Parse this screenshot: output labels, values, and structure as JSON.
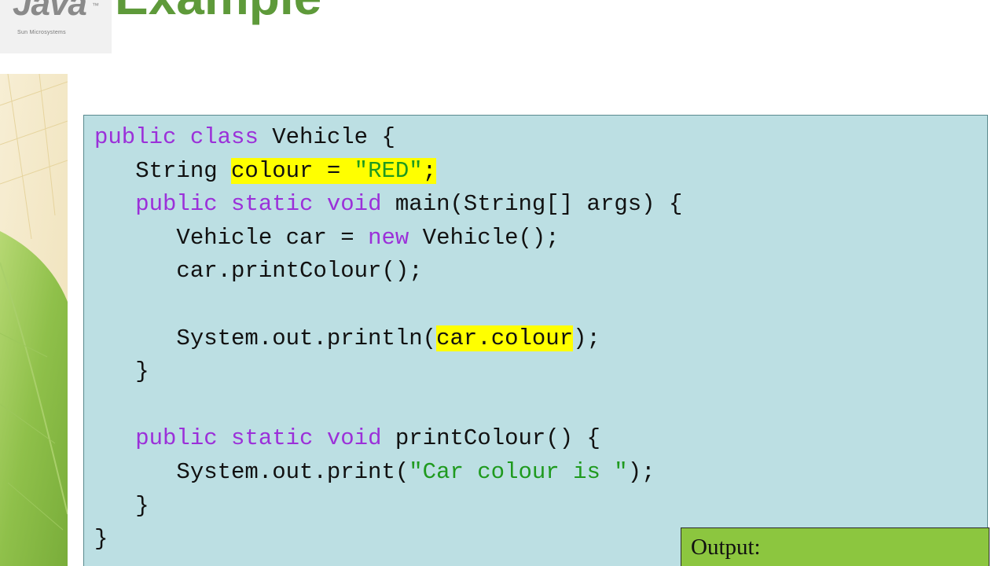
{
  "logo": {
    "word": "Java",
    "tm": "™",
    "sub": "Sun Microsystems"
  },
  "title": "Example",
  "code_lines": [
    [
      {
        "t": "public",
        "c": "kw"
      },
      {
        "t": " "
      },
      {
        "t": "class",
        "c": "kw"
      },
      {
        "t": " Vehicle {"
      }
    ],
    [
      {
        "t": "   String "
      },
      {
        "t": "colour = ",
        "c": "hl"
      },
      {
        "t": "\"RED\"",
        "c": "str hl"
      },
      {
        "t": ";",
        "c": "hl"
      }
    ],
    [
      {
        "t": "   "
      },
      {
        "t": "public",
        "c": "kw"
      },
      {
        "t": " "
      },
      {
        "t": "static",
        "c": "kw"
      },
      {
        "t": " "
      },
      {
        "t": "void",
        "c": "kw"
      },
      {
        "t": " main(String[] args) {"
      }
    ],
    [
      {
        "t": "      Vehicle car = "
      },
      {
        "t": "new",
        "c": "kw"
      },
      {
        "t": " Vehicle();"
      }
    ],
    [
      {
        "t": "      car.printColour();"
      }
    ],
    [],
    [
      {
        "t": "      System.out.println("
      },
      {
        "t": "car.colour",
        "c": "hl"
      },
      {
        "t": ");"
      }
    ],
    [
      {
        "t": "   }"
      }
    ],
    [],
    [
      {
        "t": "   "
      },
      {
        "t": "public",
        "c": "kw"
      },
      {
        "t": " "
      },
      {
        "t": "static",
        "c": "kw"
      },
      {
        "t": " "
      },
      {
        "t": "void",
        "c": "kw"
      },
      {
        "t": " printColour() {"
      }
    ],
    [
      {
        "t": "      System.out.print("
      },
      {
        "t": "\"Car colour is \"",
        "c": "str"
      },
      {
        "t": ");"
      }
    ],
    [
      {
        "t": "   }"
      }
    ],
    [
      {
        "t": "}"
      }
    ]
  ],
  "output": {
    "label": "Output:"
  },
  "colors": {
    "keyword": "#9b30d9",
    "string": "#1f9a1f",
    "highlight": "#ffff00",
    "panel": "#bcdfe3",
    "output_panel": "#8cc63f",
    "title": "#5e9a3a"
  }
}
